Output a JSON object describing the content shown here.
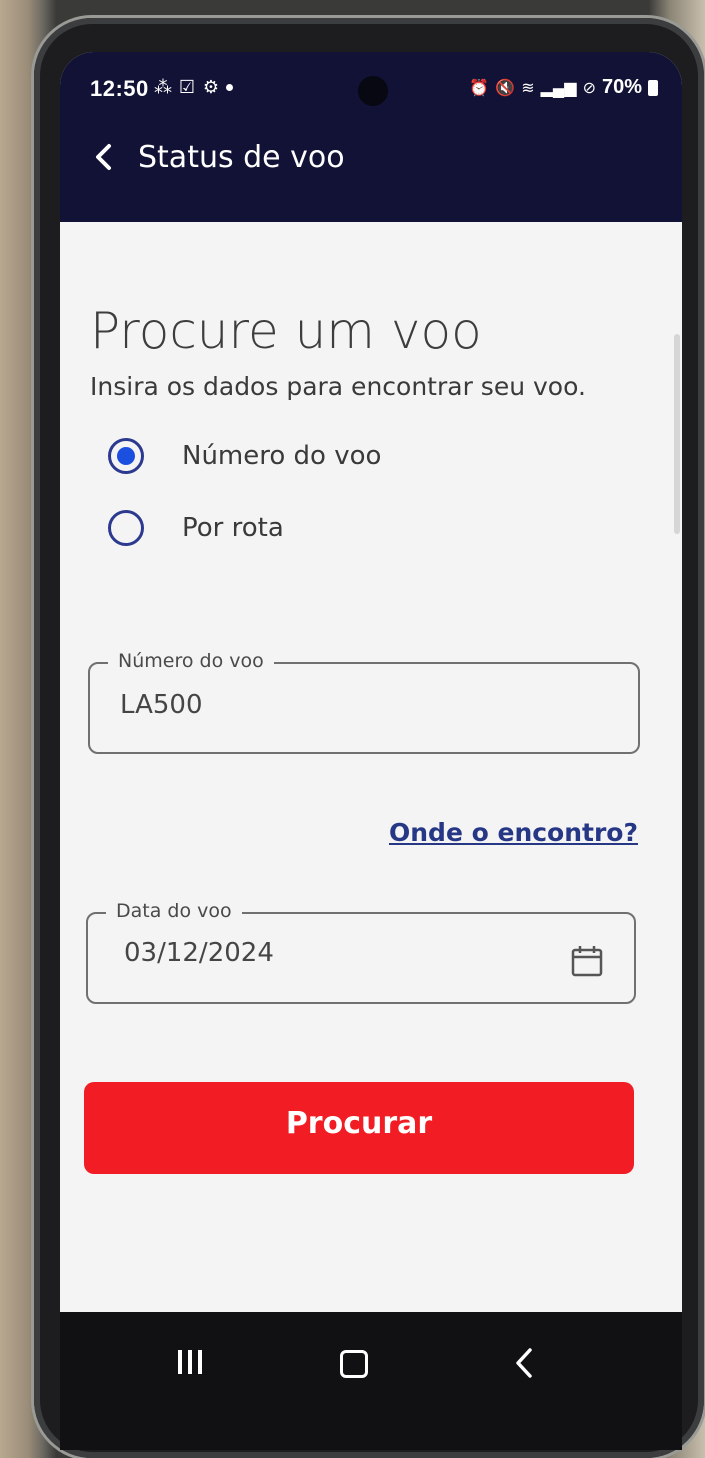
{
  "status_bar": {
    "time": "12:50",
    "battery": "70%"
  },
  "app_bar": {
    "title": "Status de voo"
  },
  "main": {
    "heading": "Procure um voo",
    "subheading": "Insira os dados para encontrar seu voo.",
    "search_options": [
      {
        "label": "Número do voo",
        "selected": true
      },
      {
        "label": "Por rota",
        "selected": false
      }
    ],
    "flight_number_field": {
      "label": "Número do voo",
      "value": "LA500"
    },
    "help_link": "Onde o encontro?",
    "flight_date_field": {
      "label": "Data do voo",
      "value": "03/12/2024"
    },
    "search_button": "Procurar"
  },
  "colors": {
    "header_bg": "#111235",
    "accent_blue": "#1b4fe0",
    "link_blue": "#263785",
    "button_red": "#f21c24"
  },
  "icons": [
    "back-arrow-icon",
    "calendar-icon",
    "recents-icon",
    "home-icon",
    "nav-back-icon"
  ]
}
